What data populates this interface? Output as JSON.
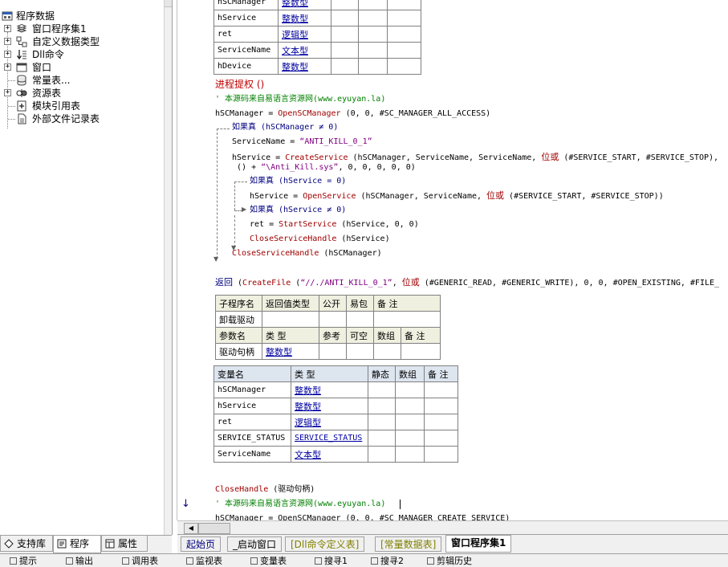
{
  "left_panel": {
    "tree": {
      "root_label": "程序数据",
      "items": [
        {
          "label": "窗口程序集1"
        },
        {
          "label": "自定义数据类型"
        },
        {
          "label": "Dll命令"
        },
        {
          "label": "窗口"
        },
        {
          "label": "常量表..."
        },
        {
          "label": "资源表"
        },
        {
          "label": "模块引用表"
        },
        {
          "label": "外部文件记录表"
        }
      ]
    },
    "tabs": [
      {
        "label": "支持库"
      },
      {
        "label": "程序"
      },
      {
        "label": "属性"
      }
    ]
  },
  "editor": {
    "top_var_table": {
      "rows": [
        {
          "name": "hSCManager",
          "type": "整数型"
        },
        {
          "name": "hService",
          "type": "整数型"
        },
        {
          "name": "ret",
          "type": "逻辑型"
        },
        {
          "name": "ServiceName",
          "type": "文本型"
        },
        {
          "name": "hDevice",
          "type": "整数型"
        }
      ]
    },
    "code_block_1": {
      "call_line": "进程提权 ()",
      "comment_line": "' 本源码来自易语言资源网(www.eyuyan.la)",
      "open_line_lhs": "hSCManager = ",
      "open_line_fn": "OpenSCManager",
      "open_line_args": " (0, 0, #SC_MANAGER_ALL_ACCESS)",
      "if1": "如果真 (hSCManager ≠ 0)",
      "servicename_lhs": "ServiceName = ",
      "servicename_val": "“ANTI_KILL_0_1”",
      "create_lhs": "hService = ",
      "create_fn": "CreateService",
      "create_args": " (hSCManager, ServiceName, ServiceName, ",
      "create_or": "位或",
      "create_tail": " (#SERVICE_START, #SERVICE_STOP),",
      "create_cont_a": " () + ",
      "create_cont_str": "“\\Anti_Kill.sys”",
      "create_cont_b": ", 0, 0, 0, 0, 0)",
      "if2": "如果真 (hService = 0)",
      "open2_lhs": "hService = ",
      "open2_fn": "OpenService",
      "open2_args": " (hSCManager, ServiceName, ",
      "open2_or": "位或",
      "open2_tail": " (#SERVICE_START, #SERVICE_STOP))",
      "if3": "如果真 (hService ≠ 0)",
      "start_lhs": "ret = ",
      "start_fn": "StartService",
      "start_args": " (hService, 0, 0)",
      "close1_fn": "CloseServiceHandle",
      "close1_args": " (hService)",
      "close2_fn": "CloseServiceHandle",
      "close2_args": " (hSCManager)",
      "return_kw": "返回",
      "return_a": " (",
      "return_fn": "CreateFile",
      "return_b": " (",
      "return_str": "“//./ANTI_KILL_0_1”",
      "return_c": ", ",
      "return_or": "位或",
      "return_tail": " (#GENERIC_READ, #GENERIC_WRITE), 0, 0, #OPEN_EXISTING, #FILE_"
    },
    "sub_table": {
      "headers": [
        "子程序名",
        "返回值类型",
        "公开",
        "易包",
        "备 注"
      ],
      "name": "卸载驱动",
      "param_headers": [
        "参数名",
        "类 型",
        "参考",
        "可空",
        "数组",
        "备 注"
      ],
      "param_name": "驱动句柄",
      "param_type": "整数型"
    },
    "var_table": {
      "headers": [
        "变量名",
        "类 型",
        "静态",
        "数组",
        "备 注"
      ],
      "rows": [
        {
          "name": "hSCManager",
          "type": "整数型"
        },
        {
          "name": "hService",
          "type": "整数型"
        },
        {
          "name": "ret",
          "type": "逻辑型"
        },
        {
          "name": "SERVICE_STATUS",
          "type": "SERVICE_STATUS"
        },
        {
          "name": "ServiceName",
          "type": "文本型"
        }
      ]
    },
    "code_block_2": {
      "close_fn": "CloseHandle",
      "close_args": " (驱动句柄)",
      "comment_line": "' 本源码来自易语言资源网(www.eyuyan.la)",
      "last_line": "hSCManager = OpenSCManager (0, 0, #SC_MANAGER_CREATE_SERVICE)"
    },
    "tabs": [
      {
        "label": "起始页"
      },
      {
        "label": "_启动窗口"
      },
      {
        "label": "[Dll命令定义表]"
      },
      {
        "label": "[常量数据表]"
      },
      {
        "label": "窗口程序集1"
      }
    ]
  },
  "bottom_tabs": [
    {
      "label": "提示"
    },
    {
      "label": "输出"
    },
    {
      "label": "调用表"
    },
    {
      "label": "监视表"
    },
    {
      "label": "变量表"
    },
    {
      "label": "搜寻1"
    },
    {
      "label": "搜寻2"
    },
    {
      "label": "剪辑历史"
    }
  ]
}
